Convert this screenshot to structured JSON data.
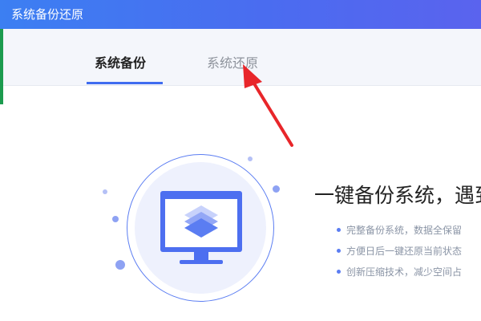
{
  "window": {
    "title": "系统备份还原"
  },
  "tabs": [
    {
      "label": "系统备份",
      "active": true
    },
    {
      "label": "系统还原",
      "active": false
    }
  ],
  "main": {
    "heading": "一键备份系统，遇到",
    "features": [
      "完整备份系统，数据全保留",
      "方便日后一键还原当前状态",
      "创新压缩技术，减少空间占"
    ]
  },
  "icons": {
    "illustration": "monitor-layers-icon",
    "annotation": "red-arrow-icon"
  },
  "colors": {
    "titlebar": "#4a6cf0",
    "accent": "#3f6cf0",
    "annotation": "#e8262a"
  }
}
